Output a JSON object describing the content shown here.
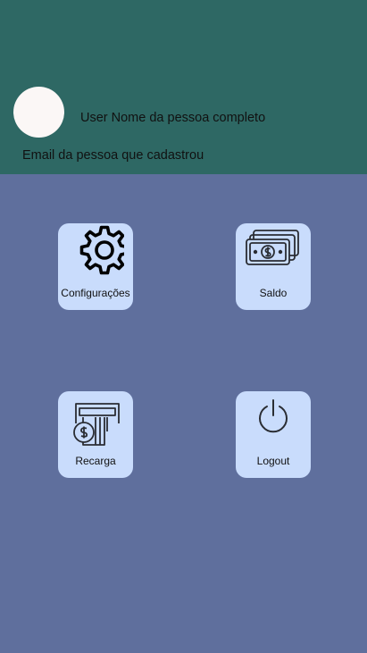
{
  "user": {
    "name": "User Nome da pessoa completo",
    "email": "Email da pessoa que cadastrou"
  },
  "menu": {
    "settings": {
      "label": "Configurações",
      "icon": "gear-icon"
    },
    "balance": {
      "label": "Saldo",
      "icon": "money-icon"
    },
    "recharge": {
      "label": "Recarga",
      "icon": "atm-card-icon"
    },
    "logout": {
      "label": "Logout",
      "icon": "power-icon"
    }
  },
  "colors": {
    "header": "#2e6864",
    "background": "#5f6f9d",
    "tile": "#c9dcfc",
    "avatar": "#fbf7f6"
  }
}
